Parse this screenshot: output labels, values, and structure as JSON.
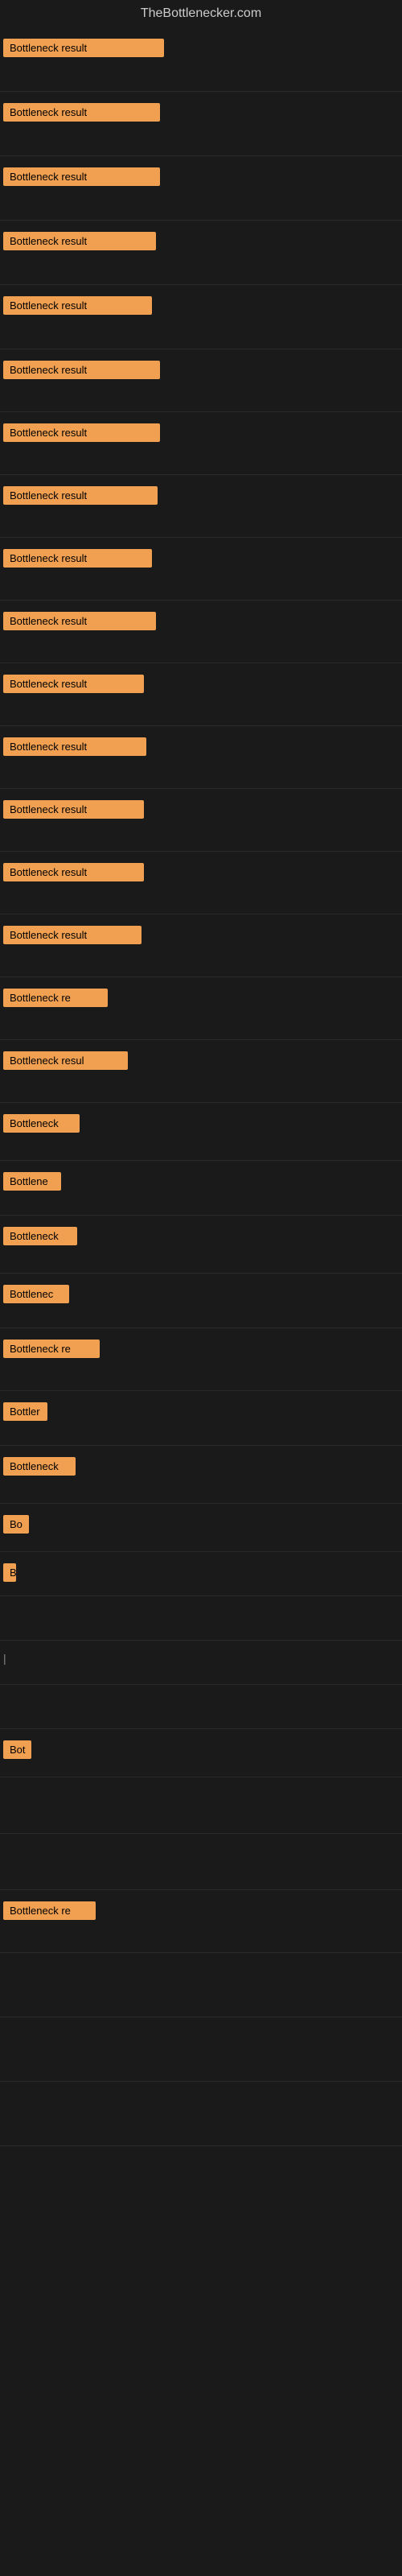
{
  "site_title": "TheBottlenecker.com",
  "badge_label": "Bottleneck result",
  "rows": [
    {
      "label": "Bottleneck result",
      "truncated": false
    },
    {
      "label": "Bottleneck result",
      "truncated": false
    },
    {
      "label": "Bottleneck result",
      "truncated": false
    },
    {
      "label": "Bottleneck result",
      "truncated": false
    },
    {
      "label": "Bottleneck result",
      "truncated": false
    },
    {
      "label": "Bottleneck result",
      "truncated": false
    },
    {
      "label": "Bottleneck result",
      "truncated": false
    },
    {
      "label": "Bottleneck result",
      "truncated": false
    },
    {
      "label": "Bottleneck result",
      "truncated": false
    },
    {
      "label": "Bottleneck result",
      "truncated": false
    },
    {
      "label": "Bottleneck result",
      "truncated": false
    },
    {
      "label": "Bottleneck result",
      "truncated": false
    },
    {
      "label": "Bottleneck result",
      "truncated": false
    },
    {
      "label": "Bottleneck result",
      "truncated": false
    },
    {
      "label": "Bottleneck result",
      "truncated": true,
      "display": "Bottleneck result"
    },
    {
      "label": "Bottleneck re",
      "truncated": true,
      "display": "Bottleneck re"
    },
    {
      "label": "Bottleneck resul",
      "truncated": true,
      "display": "Bottleneck resul"
    },
    {
      "label": "Bottleneck",
      "truncated": true,
      "display": "Bottleneck"
    },
    {
      "label": "Bottlene",
      "truncated": true,
      "display": "Bottlene"
    },
    {
      "label": "Bottleneck",
      "truncated": true,
      "display": "Bottleneck"
    },
    {
      "label": "Bottlenec",
      "truncated": true,
      "display": "Bottlenec"
    },
    {
      "label": "Bottleneck re",
      "truncated": true,
      "display": "Bottleneck re"
    },
    {
      "label": "Bottler",
      "truncated": true,
      "display": "Bottler"
    },
    {
      "label": "Bottleneck",
      "truncated": true,
      "display": "Bottleneck"
    },
    {
      "label": "Bo",
      "truncated": true,
      "display": "Bo"
    },
    {
      "label": "B",
      "truncated": true,
      "display": "B"
    },
    {
      "label": "",
      "truncated": true,
      "display": ""
    },
    {
      "label": "|",
      "truncated": true,
      "display": "|"
    },
    {
      "label": "",
      "truncated": true,
      "display": ""
    },
    {
      "label": "Bot",
      "truncated": true,
      "display": "Bot"
    },
    {
      "label": "",
      "truncated": false
    },
    {
      "label": "",
      "truncated": false
    },
    {
      "label": "Bottleneck re",
      "truncated": true,
      "display": "Bottleneck re"
    },
    {
      "label": "",
      "truncated": false
    },
    {
      "label": "",
      "truncated": false
    },
    {
      "label": "",
      "truncated": false
    }
  ]
}
